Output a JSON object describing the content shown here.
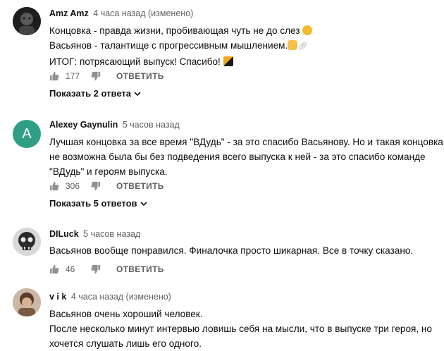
{
  "comments": [
    {
      "author": "Amz Amz",
      "time": "4 часа назад (изменено)",
      "lines": [
        "Концовка - правда жизни, пробивающая чуть не до слез",
        "Васьянов - талантище с прогрессивным мышлением.",
        "ИТОГ: потрясающий выпуск! Спасибо!"
      ],
      "likes": "177",
      "reply_label": "ОТВЕТИТЬ",
      "show_replies": "Показать 2 ответа",
      "avatar": "dark-photo"
    },
    {
      "author": "Alexey Gaynulin",
      "time": "5 часов назад",
      "lines": [
        "Лучшая концовка за все время \"ВДудь\" - за это спасибо Васьянову. Но и такая концовка",
        "не возможна была бы без подведения всего выпуска к ней - за это спасибо команде",
        "\"ВДудь\" и героям выпуска."
      ],
      "likes": "306",
      "reply_label": "ОТВЕТИТЬ",
      "show_replies": "Показать 5 ответов",
      "avatar_letter": "A",
      "avatar_color": "#2e9f84"
    },
    {
      "author": "DILuck",
      "time": "5 часов назад",
      "lines": [
        "Васьянов вообще понравился. Финалочка просто шикарная. Все в точку сказано."
      ],
      "likes": "46",
      "reply_label": "ОТВЕТИТЬ",
      "avatar": "skull-photo"
    },
    {
      "author": "v i k",
      "time": "4 часа назад (изменено)",
      "lines": [
        "Васьянов очень хороший человек.",
        "После несколько минут интервью ловишь себя на мысли, что в выпуске три героя, но",
        "хочется слушать лишь его одного."
      ],
      "avatar": "brown-photo"
    }
  ],
  "icons": {
    "like": "thumbs-up-icon",
    "dislike": "thumbs-down-icon",
    "expand": "chevron-down-icon"
  }
}
